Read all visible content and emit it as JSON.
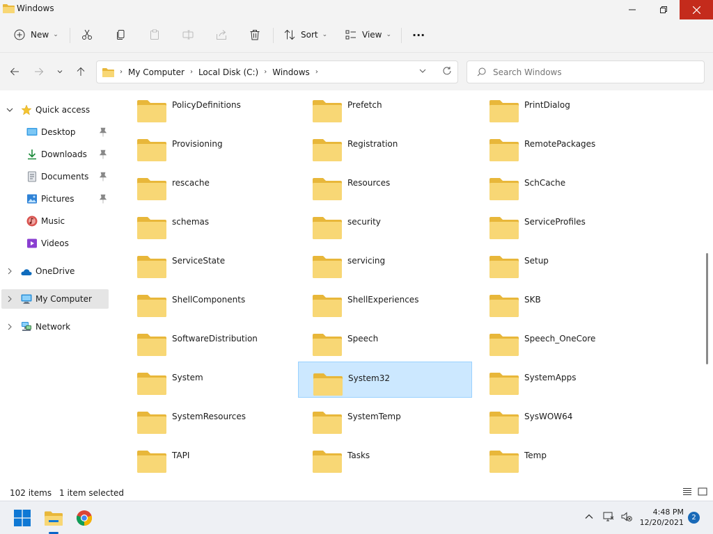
{
  "window": {
    "title": "Windows"
  },
  "toolbar": {
    "new_label": "New",
    "sort_label": "Sort",
    "view_label": "View",
    "more_label": "···"
  },
  "address": {
    "crumbs": [
      "My Computer",
      "Local Disk (C:)",
      "Windows"
    ]
  },
  "search": {
    "placeholder": "Search Windows"
  },
  "sidebar": {
    "items": [
      {
        "label": "Quick access"
      },
      {
        "label": "Desktop"
      },
      {
        "label": "Downloads"
      },
      {
        "label": "Documents"
      },
      {
        "label": "Pictures"
      },
      {
        "label": "Music"
      },
      {
        "label": "Videos"
      },
      {
        "label": "OneDrive"
      },
      {
        "label": "My Computer"
      },
      {
        "label": "Network"
      }
    ]
  },
  "folders": [
    [
      "PolicyDefinitions",
      "Prefetch",
      "PrintDialog"
    ],
    [
      "Provisioning",
      "Registration",
      "RemotePackages"
    ],
    [
      "rescache",
      "Resources",
      "SchCache"
    ],
    [
      "schemas",
      "security",
      "ServiceProfiles"
    ],
    [
      "ServiceState",
      "servicing",
      "Setup"
    ],
    [
      "ShellComponents",
      "ShellExperiences",
      "SKB"
    ],
    [
      "SoftwareDistribution",
      "Speech",
      "Speech_OneCore"
    ],
    [
      "System",
      "System32",
      "SystemApps"
    ],
    [
      "SystemResources",
      "SystemTemp",
      "SysWOW64"
    ],
    [
      "TAPI",
      "Tasks",
      "Temp"
    ]
  ],
  "status": {
    "item_count": "102 items",
    "selection": "1 item selected"
  },
  "clock": {
    "time": "4:48 PM",
    "date": "12/20/2021"
  },
  "notifications": {
    "count": "2"
  },
  "colors": {
    "accent": "#0a64c8",
    "selection": "#cce8ff",
    "close": "#c42b1c",
    "folder": "#f8d775"
  }
}
